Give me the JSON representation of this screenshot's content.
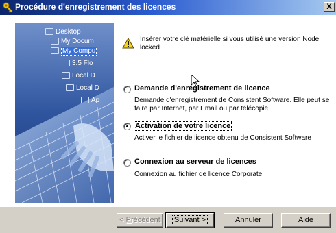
{
  "window": {
    "title": "Procédure d'enregistrement des licences",
    "close_label": "X"
  },
  "side_image": {
    "tree_items": [
      {
        "label": "Desktop",
        "selected": false
      },
      {
        "label": "My Docum",
        "selected": false
      },
      {
        "label": "My Compu",
        "selected": true
      },
      {
        "label": "3.5 Flo",
        "selected": false
      },
      {
        "label": "Local D",
        "selected": false
      },
      {
        "label": "Local D",
        "selected": false
      },
      {
        "label": "Ap",
        "selected": false
      }
    ]
  },
  "warning": {
    "text": "Insérer votre clé matérielle si vous utilisé une version Node locked"
  },
  "options": [
    {
      "title": "Demande d'enregistrement de licence",
      "description": "Demande d'enregistrement de Consistent Software. Elle peut se faire par Internet, par Email ou par télécopie.",
      "checked": false
    },
    {
      "title": "Activation de votre licence",
      "description": "Activer le fichier de licence obtenu de Consistent Software",
      "checked": true
    },
    {
      "title": "Connexion au serveur de licences",
      "description": "Connexion au fichier de licence Corporate",
      "checked": false
    }
  ],
  "buttons": {
    "previous": {
      "prefix": "< ",
      "accel": "P",
      "rest": "récédent"
    },
    "next": {
      "accel": "S",
      "rest": "uivant >"
    },
    "cancel": "Annuler",
    "help": "Aide"
  },
  "colors": {
    "titlebar_start": "#0a246a",
    "titlebar_end": "#a6caf0",
    "dialog_face": "#d4d0c8",
    "warning_yellow": "#f7d117"
  }
}
